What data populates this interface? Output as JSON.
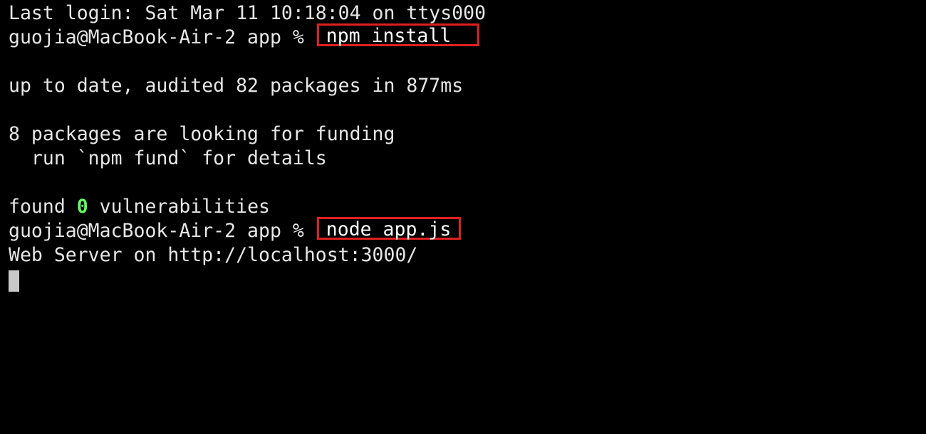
{
  "terminal": {
    "last_login": "Last login: Sat Mar 11 10:18:04 on ttys000",
    "prompt1": "guojia@MacBook-Air-2 app % ",
    "command1": "npm install",
    "output_audit": "up to date, audited 82 packages in 877ms",
    "output_funding": "8 packages are looking for funding",
    "output_fund_hint": "  run `npm fund` for details",
    "vuln_prefix": "found ",
    "vuln_count": "0",
    "vuln_suffix": " vulnerabilities",
    "prompt2": "guojia@MacBook-Air-2 app % ",
    "command2": "node app.js",
    "server_output": "Web Server on http://localhost:3000/"
  },
  "colors": {
    "background": "#000000",
    "text": "#e6e6e6",
    "highlight_border": "#e02020",
    "success_green": "#5fff5f",
    "cursor": "#c8c8c8"
  }
}
